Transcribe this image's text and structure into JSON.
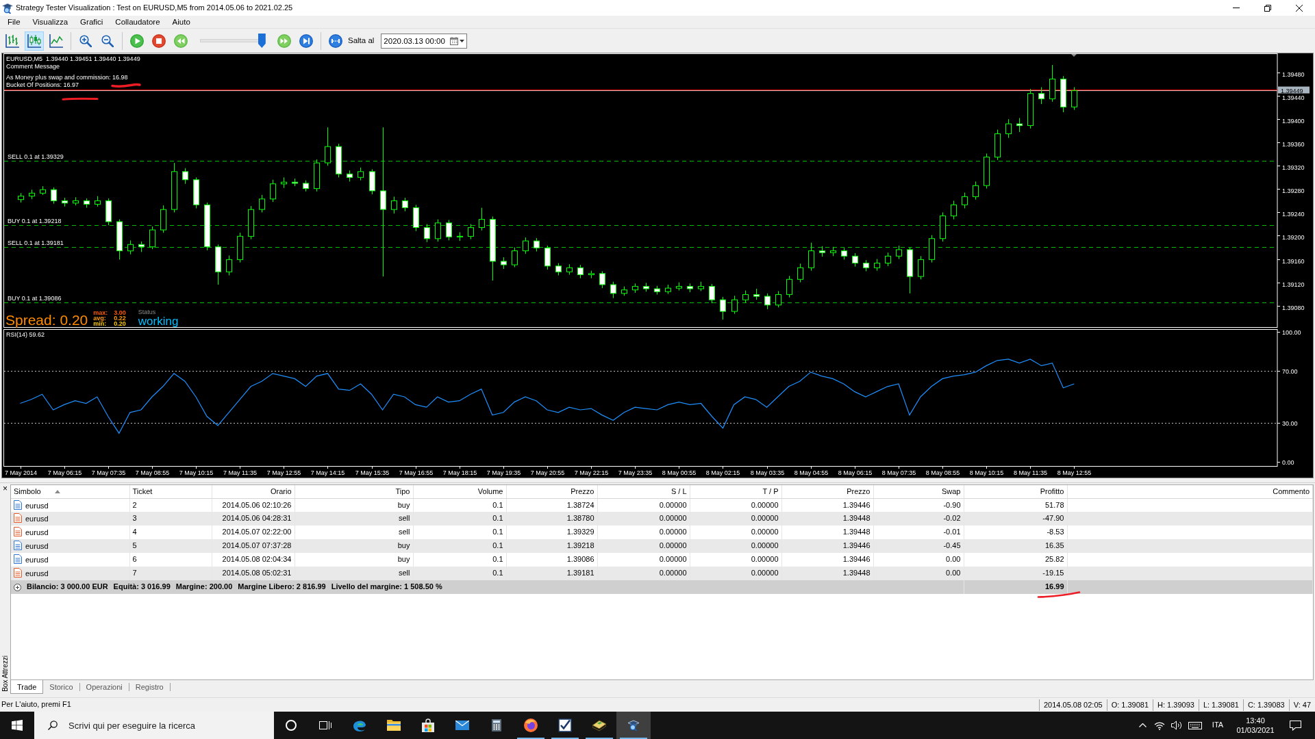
{
  "window": {
    "title": "Strategy Tester Visualization : Test on EURUSD,M5 from 2014.05.06 to 2021.02.25"
  },
  "menu": [
    "File",
    "Visualizza",
    "Grafici",
    "Collaudatore",
    "Aiuto"
  ],
  "toolbar": {
    "chart_modes": [
      {
        "kind": "bars",
        "selected": false
      },
      {
        "kind": "candles",
        "selected": true
      },
      {
        "kind": "line",
        "selected": false
      }
    ],
    "speed": {
      "level": 0.95
    },
    "jump_label": "Salta al",
    "jump_date": "2020.03.13 00:00"
  },
  "chart": {
    "chart_data": [
      {
        "type": "candlestick",
        "title": "EURUSD,M5  1.39440 1.39451 1.39440 1.39449",
        "tick_labels": "y",
        "ylim": [
          1.39042,
          1.39513
        ],
        "yticks": [
          {
            "value": 1.3908,
            "label": "1.39080"
          },
          {
            "value": 1.3912,
            "label": "1.39120"
          },
          {
            "value": 1.3916,
            "label": "1.39160"
          },
          {
            "value": 1.392,
            "label": "1.39200"
          },
          {
            "value": 1.3924,
            "label": "1.39240"
          },
          {
            "value": 1.3928,
            "label": "1.39280"
          },
          {
            "value": 1.3932,
            "label": "1.39320"
          },
          {
            "value": 1.3936,
            "label": "1.39360"
          },
          {
            "value": 1.394,
            "label": "1.39400"
          },
          {
            "value": 1.3944,
            "label": "1.39440"
          },
          {
            "value": 1.3948,
            "label": "1.39480"
          }
        ],
        "ref_lines": [
          {
            "axis": "y",
            "value": 1.39329,
            "label": "SELL 0.1 at 1.39329",
            "color": "#00c000",
            "line_style": "dashed"
          },
          {
            "axis": "y",
            "value": 1.39218,
            "label": "BUY 0.1 at 1.39218",
            "color": "#00c000",
            "line_style": "dashed"
          },
          {
            "axis": "y",
            "value": 1.39181,
            "label": "SELL 0.1 at 1.39181",
            "color": "#00c000",
            "line_style": "dashed"
          },
          {
            "axis": "y",
            "value": 1.39086,
            "label": "BUY 0.1 at 1.39086",
            "color": "#00c000",
            "line_style": "dashed"
          },
          {
            "axis": "y",
            "value": 1.39451,
            "color": "#ff0000",
            "line_style": "solid"
          },
          {
            "axis": "y",
            "value": 1.39449,
            "label": "1.39449",
            "color": "#c0c0c0",
            "line_style": "solid"
          }
        ],
        "ohlc": [
          null,
          [
            1.39262,
            1.39273,
            1.39257,
            1.39268
          ],
          [
            1.39268,
            1.39279,
            1.39263,
            1.39273
          ],
          [
            1.39273,
            1.39285,
            1.3927,
            1.39279
          ],
          [
            1.39279,
            1.39283,
            1.39255,
            1.3926
          ],
          [
            1.3926,
            1.39265,
            1.3925,
            1.39256
          ],
          [
            1.39256,
            1.39266,
            1.39252,
            1.3926
          ],
          [
            1.3926,
            1.39264,
            1.39248,
            1.39254
          ],
          [
            1.39254,
            1.39268,
            1.3925,
            1.3926
          ],
          [
            1.3926,
            1.39264,
            1.39218,
            1.39224
          ],
          [
            1.39224,
            1.39228,
            1.39159,
            1.39174
          ],
          [
            1.39174,
            1.39192,
            1.39168,
            1.39185
          ],
          [
            1.39185,
            1.3919,
            1.39172,
            1.39181
          ],
          [
            1.39181,
            1.39216,
            1.39177,
            1.3921
          ],
          [
            1.3921,
            1.39252,
            1.39205,
            1.39245
          ],
          [
            1.39245,
            1.39325,
            1.3924,
            1.3931
          ],
          [
            1.3931,
            1.39316,
            1.39289,
            1.39296
          ],
          [
            1.39296,
            1.393,
            1.39247,
            1.39253
          ],
          [
            1.39253,
            1.39257,
            1.39175,
            1.39181
          ],
          [
            1.39181,
            1.39185,
            1.39116,
            1.39138
          ],
          [
            1.39138,
            1.39166,
            1.39132,
            1.39159
          ],
          [
            1.39159,
            1.39205,
            1.39154,
            1.39199
          ],
          [
            1.39199,
            1.39251,
            1.39194,
            1.39245
          ],
          [
            1.39245,
            1.3927,
            1.3924,
            1.39263
          ],
          [
            1.39263,
            1.39296,
            1.39258,
            1.39289
          ],
          [
            1.39289,
            1.393,
            1.39282,
            1.39292
          ],
          [
            1.39292,
            1.39298,
            1.39285,
            1.3929
          ],
          [
            1.3929,
            1.39295,
            1.39276,
            1.39281
          ],
          [
            1.39281,
            1.39331,
            1.39276,
            1.39325
          ],
          [
            1.39325,
            1.39386,
            1.3932,
            1.39353
          ],
          [
            1.39353,
            1.39358,
            1.393,
            1.39306
          ],
          [
            1.39306,
            1.39312,
            1.39293,
            1.393
          ],
          [
            1.393,
            1.39317,
            1.39295,
            1.3931
          ],
          [
            1.3931,
            1.39314,
            1.39271,
            1.39277
          ],
          [
            1.39277,
            1.39386,
            1.3913,
            1.39245
          ],
          [
            1.39245,
            1.39267,
            1.39238,
            1.3926
          ],
          [
            1.3926,
            1.39265,
            1.39242,
            1.39248
          ],
          [
            1.39248,
            1.39253,
            1.39208,
            1.39214
          ],
          [
            1.39214,
            1.3922,
            1.39189,
            1.39195
          ],
          [
            1.39195,
            1.39228,
            1.3919,
            1.39222
          ],
          [
            1.39222,
            1.39227,
            1.39192,
            1.39198
          ],
          [
            1.39198,
            1.39206,
            1.39191,
            1.39199
          ],
          [
            1.39199,
            1.3922,
            1.39194,
            1.39214
          ],
          [
            1.39214,
            1.39248,
            1.39209,
            1.39228
          ],
          [
            1.39228,
            1.39233,
            1.39123,
            1.39156
          ],
          [
            1.39156,
            1.39163,
            1.39143,
            1.3915
          ],
          [
            1.3915,
            1.3918,
            1.39146,
            1.39174
          ],
          [
            1.39174,
            1.39197,
            1.39169,
            1.39191
          ],
          [
            1.39191,
            1.39196,
            1.39173,
            1.39179
          ],
          [
            1.39179,
            1.39183,
            1.39142,
            1.39148
          ],
          [
            1.39148,
            1.39153,
            1.39132,
            1.39138
          ],
          [
            1.39138,
            1.39151,
            1.39133,
            1.39145
          ],
          [
            1.39145,
            1.3915,
            1.39127,
            1.39133
          ],
          [
            1.39133,
            1.3914,
            1.39127,
            1.39135
          ],
          [
            1.39135,
            1.39139,
            1.3911,
            1.39116
          ],
          [
            1.39116,
            1.39121,
            1.39093,
            1.39101
          ],
          [
            1.39101,
            1.39113,
            1.39097,
            1.39107
          ],
          [
            1.39107,
            1.39118,
            1.39102,
            1.39113
          ],
          [
            1.39113,
            1.39119,
            1.39104,
            1.39109
          ],
          [
            1.39109,
            1.39114,
            1.39099,
            1.39104
          ],
          [
            1.39104,
            1.39116,
            1.391,
            1.3911
          ],
          [
            1.3911,
            1.3912,
            1.39106,
            1.39113
          ],
          [
            1.39113,
            1.39118,
            1.39103,
            1.39109
          ],
          [
            1.39109,
            1.39121,
            1.39105,
            1.39113
          ],
          [
            1.39113,
            1.39117,
            1.39084,
            1.3909
          ],
          [
            1.3909,
            1.39095,
            1.39056,
            1.3907
          ],
          [
            1.3907,
            1.39097,
            1.39066,
            1.3909
          ],
          [
            1.3909,
            1.39106,
            1.39085,
            1.39099
          ],
          [
            1.39099,
            1.39109,
            1.3909,
            1.39096
          ],
          [
            1.39096,
            1.39101,
            1.39074,
            1.39081
          ],
          [
            1.39081,
            1.39105,
            1.39077,
            1.39099
          ],
          [
            1.39099,
            1.39131,
            1.39094,
            1.39125
          ],
          [
            1.39125,
            1.39152,
            1.3912,
            1.39145
          ],
          [
            1.39145,
            1.39188,
            1.3914,
            1.39174
          ],
          [
            1.39174,
            1.39182,
            1.39164,
            1.39171
          ],
          [
            1.39171,
            1.39181,
            1.39165,
            1.39174
          ],
          [
            1.39174,
            1.39179,
            1.39159,
            1.39165
          ],
          [
            1.39165,
            1.3917,
            1.39147,
            1.39153
          ],
          [
            1.39153,
            1.39158,
            1.39139,
            1.39145
          ],
          [
            1.39145,
            1.3916,
            1.3914,
            1.39153
          ],
          [
            1.39153,
            1.39171,
            1.39148,
            1.39165
          ],
          [
            1.39165,
            1.39183,
            1.3916,
            1.39176
          ],
          [
            1.39176,
            1.3918,
            1.39101,
            1.3913
          ],
          [
            1.3913,
            1.39165,
            1.39125,
            1.39159
          ],
          [
            1.39159,
            1.39201,
            1.39154,
            1.39195
          ],
          [
            1.39195,
            1.3924,
            1.3919,
            1.39234
          ],
          [
            1.39234,
            1.3926,
            1.39228,
            1.39253
          ],
          [
            1.39253,
            1.39274,
            1.39247,
            1.39267
          ],
          [
            1.39267,
            1.39293,
            1.39262,
            1.39286
          ],
          [
            1.39286,
            1.39341,
            1.39281,
            1.39335
          ],
          [
            1.39335,
            1.39382,
            1.3933,
            1.39375
          ],
          [
            1.39375,
            1.394,
            1.39368,
            1.39392
          ],
          [
            1.39392,
            1.39402,
            1.39378,
            1.39389
          ],
          [
            1.39389,
            1.39452,
            1.39384,
            1.39444
          ],
          [
            1.39444,
            1.39455,
            1.39426,
            1.39435
          ],
          [
            1.39435,
            1.39493,
            1.3943,
            1.39469
          ],
          [
            1.39469,
            1.39474,
            1.39412,
            1.39421
          ],
          [
            1.39421,
            1.39455,
            1.39416,
            1.39449
          ],
          null,
          null,
          null,
          null,
          null,
          null,
          null,
          null,
          null,
          null,
          null,
          null,
          null,
          null,
          null,
          null,
          null,
          null
        ]
      },
      {
        "type": "line",
        "title": "RSI(14) 59.62",
        "color": "#1e90ff",
        "ylim": [
          -3.7,
          102.1
        ],
        "yticks": [
          {
            "value": 100,
            "label": "100.00"
          },
          {
            "value": 70,
            "label": "70.00"
          },
          {
            "value": 30,
            "label": "30.00"
          },
          {
            "value": 0,
            "label": "0.00"
          }
        ],
        "ref_lines": [
          {
            "axis": "y",
            "value": 70,
            "color": "#c0c0c0",
            "line_style": "dotted"
          },
          {
            "axis": "y",
            "value": 30,
            "color": "#c0c0c0",
            "line_style": "dotted"
          }
        ],
        "categories": [
          null,
          "7 May 2014",
          null,
          null,
          null,
          "7 May 06:15",
          null,
          null,
          null,
          "7 May 07:35",
          null,
          null,
          null,
          "7 May 08:55",
          null,
          null,
          null,
          "7 May 10:15",
          null,
          null,
          null,
          "7 May 11:35",
          null,
          null,
          null,
          "7 May 12:55",
          null,
          null,
          null,
          "7 May 14:15",
          null,
          null,
          null,
          "7 May 15:35",
          null,
          null,
          null,
          "7 May 16:55",
          null,
          null,
          null,
          "7 May 18:15",
          null,
          null,
          null,
          "7 May 19:35",
          null,
          null,
          null,
          "7 May 20:55",
          null,
          null,
          null,
          "7 May 22:15",
          null,
          null,
          null,
          "7 May 23:35",
          null,
          null,
          null,
          "8 May 00:55",
          null,
          null,
          null,
          "8 May 02:15",
          null,
          null,
          null,
          "8 May 03:35",
          null,
          null,
          null,
          "8 May 04:55",
          null,
          null,
          null,
          "8 May 06:15",
          null,
          null,
          null,
          "8 May 07:35",
          null,
          null,
          null,
          "8 May 08:55",
          null,
          null,
          null,
          "8 May 10:15",
          null,
          null,
          null,
          "8 May 11:35",
          null,
          null,
          null,
          "8 May 12:55",
          null,
          null,
          null,
          null,
          null,
          null,
          null,
          null,
          null,
          null,
          null,
          null,
          null,
          null,
          null,
          null,
          null,
          null
        ],
        "values": [
          null,
          45,
          48,
          52,
          40,
          44,
          47,
          45,
          50,
          35,
          22,
          38,
          40,
          50,
          58,
          68,
          62,
          50,
          35,
          28,
          38,
          48,
          58,
          62,
          68,
          66,
          64,
          58,
          66,
          68,
          56,
          55,
          60,
          52,
          40,
          52,
          50,
          44,
          42,
          50,
          46,
          47,
          52,
          56,
          36,
          38,
          46,
          50,
          47,
          40,
          38,
          42,
          40,
          41,
          36,
          32,
          38,
          42,
          41,
          40,
          44,
          46,
          44,
          45,
          35,
          26,
          44,
          50,
          48,
          42,
          50,
          58,
          62,
          69,
          66,
          64,
          60,
          54,
          50,
          54,
          58,
          60,
          36,
          50,
          58,
          64,
          66,
          67,
          69,
          74,
          78,
          79,
          76,
          79,
          74,
          76,
          57,
          60,
          null,
          null,
          null,
          null,
          null,
          null,
          null,
          null,
          null,
          null,
          null,
          null,
          null,
          null,
          null,
          null,
          null,
          null
        ]
      }
    ],
    "comment": {
      "title": "Comment Message",
      "lines": [
        "As Money plus swap and commission: 16.98",
        "Bucket Of Positions: 16.97"
      ]
    },
    "spread": {
      "label": "Spread: 0.20",
      "stats": [
        {
          "label": "max:",
          "value": "3.00",
          "color": "#ff5a00"
        },
        {
          "label": "avg:",
          "value": "0.22",
          "color": "#ff9900"
        },
        {
          "label": "min:",
          "value": "0.20",
          "color": "#ffcc00"
        }
      ]
    },
    "status": {
      "label": "Status",
      "value": "working"
    }
  },
  "terminal": {
    "close": "×",
    "side_label": "Box Attrezzi",
    "columns": [
      {
        "label": "Simbolo",
        "sorted": true
      },
      {
        "label": "Ticket",
        "sorted": false
      },
      {
        "label": "Orario",
        "sorted": false
      },
      {
        "label": "Tipo",
        "sorted": false
      },
      {
        "label": "Volume",
        "sorted": false
      },
      {
        "label": "Prezzo",
        "sorted": false
      },
      {
        "label": "S / L",
        "sorted": false
      },
      {
        "label": "T / P",
        "sorted": false
      },
      {
        "label": "Prezzo",
        "sorted": false
      },
      {
        "label": "Swap",
        "sorted": false
      },
      {
        "label": "Profitto",
        "sorted": false
      },
      {
        "label": "Commento",
        "sorted": false
      }
    ],
    "rows": [
      {
        "kind": "buy",
        "cells": [
          "eurusd",
          "2",
          "2014.05.06 02:10:26",
          "buy",
          "0.1",
          "1.38724",
          "0.00000",
          "0.00000",
          "1.39446",
          "-0.90",
          "51.78"
        ]
      },
      {
        "kind": "sell",
        "cells": [
          "eurusd",
          "3",
          "2014.05.06 04:28:31",
          "sell",
          "0.1",
          "1.38780",
          "0.00000",
          "0.00000",
          "1.39448",
          "-0.02",
          "-47.90"
        ]
      },
      {
        "kind": "sell",
        "cells": [
          "eurusd",
          "4",
          "2014.05.07 02:22:00",
          "sell",
          "0.1",
          "1.39329",
          "0.00000",
          "0.00000",
          "1.39448",
          "-0.01",
          "-8.53"
        ]
      },
      {
        "kind": "buy",
        "cells": [
          "eurusd",
          "5",
          "2014.05.07 07:37:28",
          "buy",
          "0.1",
          "1.39218",
          "0.00000",
          "0.00000",
          "1.39446",
          "-0.45",
          "16.35"
        ]
      },
      {
        "kind": "buy",
        "cells": [
          "eurusd",
          "6",
          "2014.05.08 02:04:34",
          "buy",
          "0.1",
          "1.39086",
          "0.00000",
          "0.00000",
          "1.39446",
          "0.00",
          "25.82"
        ]
      },
      {
        "kind": "sell",
        "cells": [
          "eurusd",
          "7",
          "2014.05.08 05:02:31",
          "sell",
          "0.1",
          "1.39181",
          "0.00000",
          "0.00000",
          "1.39448",
          "0.00",
          "-19.15"
        ]
      }
    ],
    "summary": {
      "items": [
        "Bilancio: 3 000.00 EUR",
        "Equità: 3 016.99",
        "Margine: 200.00",
        "Margine Libero: 2 816.99",
        "Livello del margine: 1 508.50 %"
      ],
      "profit": "16.99"
    },
    "tabs": [
      {
        "label": "Trade",
        "selected": true
      },
      {
        "label": "Storico",
        "selected": false
      },
      {
        "label": "Operazioni",
        "selected": false
      },
      {
        "label": "Registro",
        "selected": false
      }
    ]
  },
  "status_bar": {
    "help": "Per L'aiuto, premi F1",
    "fields": [
      "2014.05.08 02:05",
      "O: 1.39081",
      "H: 1.39093",
      "L: 1.39081",
      "C: 1.39083",
      "V: 47"
    ]
  },
  "taskbar": {
    "search": {
      "placeholder": "Scrivi qui per eseguire la ricerca"
    },
    "apps": [
      {
        "kind": "circle",
        "running": false,
        "active": false
      },
      {
        "kind": "task_view",
        "running": false,
        "active": false
      },
      {
        "kind": "swirl",
        "running": false,
        "active": false
      },
      {
        "kind": "folder",
        "running": false,
        "active": false
      },
      {
        "kind": "bag",
        "running": false,
        "active": false
      },
      {
        "kind": "envelope",
        "running": false,
        "active": false
      },
      {
        "kind": "calculator",
        "running": false,
        "active": false
      },
      {
        "kind": "globe",
        "running": true,
        "active": false
      },
      {
        "kind": "checkmark",
        "running": true,
        "active": false
      },
      {
        "kind": "book",
        "running": true,
        "active": false
      },
      {
        "kind": "mortarboard",
        "running": true,
        "active": true
      }
    ],
    "tray": {
      "language": "ITA",
      "time": "13:40",
      "date": "01/03/2021"
    }
  }
}
